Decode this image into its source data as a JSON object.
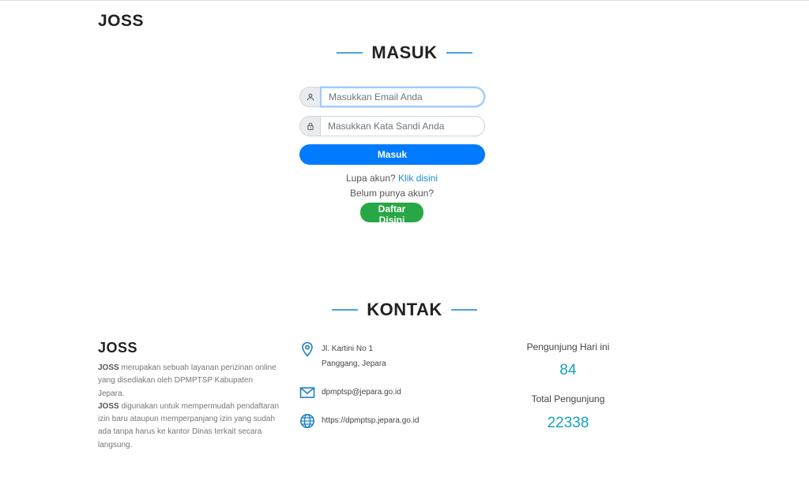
{
  "header": {
    "brand": "JOSS"
  },
  "login": {
    "title": "MASUK",
    "email_placeholder": "Masukkan Email Anda",
    "password_placeholder": "Masukkan Kata Sandi Anda",
    "submit_label": "Masuk",
    "forgot_text": "Lupa akun?",
    "forgot_link": "Klik disini",
    "no_account_text": "Belum punya akun?",
    "register_label": "Daftar Disini"
  },
  "contact": {
    "title": "KONTAK",
    "brand": "JOSS",
    "about_p1_bold": "JOSS",
    "about_p1": " merupakan sebuah layanan perizinan online yang disediakan oleh DPMPTSP Kabupaten Jepara.",
    "about_p2_bold": "JOSS",
    "about_p2": " digunakan untuk mempermudah pendaftaran izin baru ataupun memperpanjang izin yang sudah ada tanpa harus ke kantor Dinas terkait secara langsung.",
    "address_line1": "Jl. Kartini No 1",
    "address_line2": "Panggang, Jepara",
    "email": "dpmptsp@jepara.go.id",
    "website": "https://dpmptsp.jepara.go.id",
    "visitors_today_label": "Pengunjung Hari ini",
    "visitors_today": "84",
    "visitors_total_label": "Total Pengunjung",
    "visitors_total": "22338"
  },
  "colors": {
    "primary": "#007bff",
    "success": "#28a745",
    "accent": "#4aa3df",
    "stat": "#17a2b8"
  },
  "icons": [
    "user-icon",
    "lock-icon",
    "location-pin-icon",
    "mail-icon",
    "globe-icon"
  ]
}
